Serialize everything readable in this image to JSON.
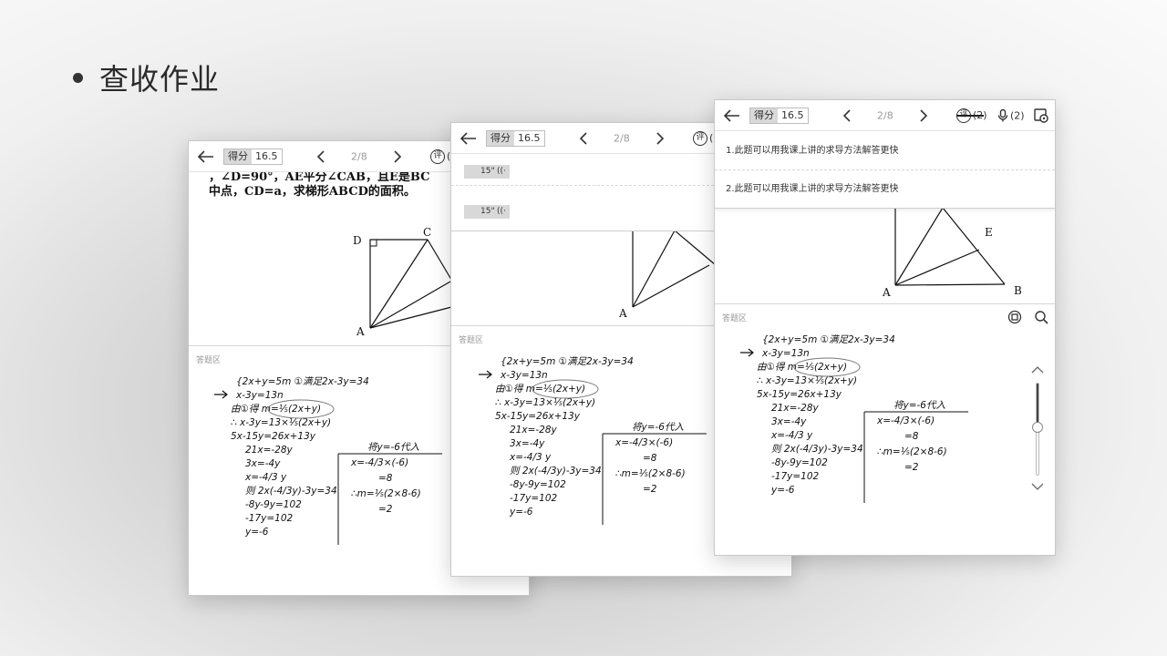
{
  "slide": {
    "title": "查收作业"
  },
  "topbar": {
    "score_label": "得分",
    "score_value": "16.5",
    "page": "2/8",
    "review_glyph": "评",
    "review_count": "(2)",
    "voice_count": "(2)"
  },
  "panel1": {
    "problem_lines": [
      "，∠D=90°，AE平分∠CAB，且E是BC",
      "中点，CD=a，求梯形ABCD的面积。"
    ],
    "labels": {
      "D": "D",
      "C": "C",
      "A": "A"
    },
    "answer_label": "答题区"
  },
  "panel2": {
    "audio": [
      {
        "duration": "15\""
      },
      {
        "duration": "15\""
      }
    ],
    "labels": {
      "A": "A"
    },
    "answer_label": "答题区"
  },
  "panel3": {
    "comments": [
      "1.此题可以用我课上讲的求导方法解答更快",
      "2.此题可以用我课上讲的求导方法解答更快"
    ],
    "labels": {
      "E": "E",
      "A": "A",
      "B": "B"
    },
    "answer_label": "答题区"
  },
  "handwriting": {
    "lines": [
      "{2x+y=5m  ①满足2x-3y=34",
      " x-3y=13n",
      "由①得 m=⅕(2x+y)",
      "∴ x-3y=13×⅕(2x+y)",
      "5x-15y=26x+13y",
      "21x=-28y",
      "3x=-4y",
      "x=-4/3 y",
      "则 2x(-4/3y)-3y=34",
      "-8y-9y=102",
      "-17y=102",
      "y=-6"
    ],
    "side_lines": [
      "将y=-6代入",
      "x=-4/3×(-6)",
      "=8",
      "∴m=⅕(2×8-6)",
      "=2"
    ]
  },
  "colors": {
    "panel_bg": "#ffffff",
    "ink": "#111111",
    "muted": "#9a9a9a",
    "score_label_bg": "#d9d9d9"
  },
  "icons": [
    "back-arrow-icon",
    "chevron-left-icon",
    "chevron-right-icon",
    "review-icon",
    "microphone-icon",
    "settings-icon",
    "speaker-icon",
    "fullscreen-icon",
    "search-icon",
    "chevron-up-icon",
    "chevron-down-icon"
  ]
}
